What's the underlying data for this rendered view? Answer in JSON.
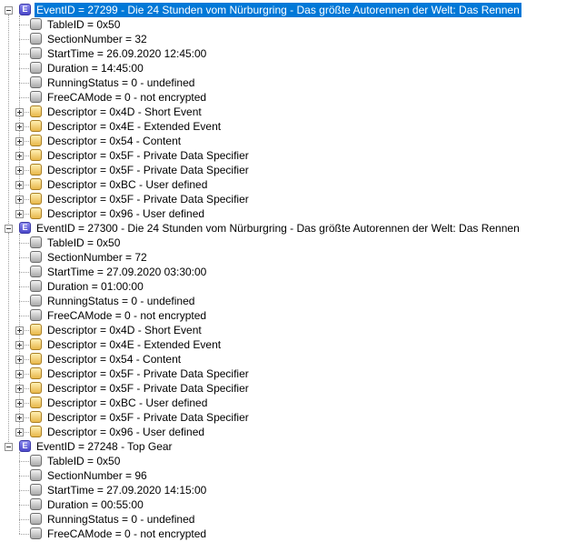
{
  "tree": {
    "events": [
      {
        "label": "EventID = 27299 - Die 24 Stunden vom Nürburgring - Das größte Autorennen der Welt: Das Rennen",
        "icon": "event-icon",
        "icon_text": "E",
        "selected": true,
        "children": [
          {
            "type": "field",
            "icon": "grey",
            "label": "TableID = 0x50"
          },
          {
            "type": "field",
            "icon": "grey",
            "label": "SectionNumber = 32"
          },
          {
            "type": "field",
            "icon": "grey",
            "label": "StartTime = 26.09.2020 12:45:00"
          },
          {
            "type": "field",
            "icon": "grey",
            "label": "Duration = 14:45:00"
          },
          {
            "type": "field",
            "icon": "grey",
            "label": "RunningStatus = 0 - undefined"
          },
          {
            "type": "field",
            "icon": "grey",
            "label": "FreeCAMode = 0 - not encrypted"
          },
          {
            "type": "descriptor",
            "icon": "yellow",
            "label": "Descriptor = 0x4D - Short Event"
          },
          {
            "type": "descriptor",
            "icon": "yellow",
            "label": "Descriptor = 0x4E - Extended Event"
          },
          {
            "type": "descriptor",
            "icon": "yellow",
            "label": "Descriptor = 0x54 - Content"
          },
          {
            "type": "descriptor",
            "icon": "yellow",
            "label": "Descriptor = 0x5F - Private Data Specifier"
          },
          {
            "type": "descriptor",
            "icon": "yellow",
            "label": "Descriptor = 0x5F - Private Data Specifier"
          },
          {
            "type": "descriptor",
            "icon": "yellow",
            "label": "Descriptor = 0xBC - User defined"
          },
          {
            "type": "descriptor",
            "icon": "yellow",
            "label": "Descriptor = 0x5F - Private Data Specifier"
          },
          {
            "type": "descriptor",
            "icon": "yellow",
            "label": "Descriptor = 0x96 - User defined"
          }
        ]
      },
      {
        "label": "EventID = 27300 - Die 24 Stunden vom Nürburgring - Das größte Autorennen der Welt: Das Rennen",
        "icon": "event-icon",
        "icon_text": "E",
        "selected": false,
        "children": [
          {
            "type": "field",
            "icon": "grey",
            "label": "TableID = 0x50"
          },
          {
            "type": "field",
            "icon": "grey",
            "label": "SectionNumber = 72"
          },
          {
            "type": "field",
            "icon": "grey",
            "label": "StartTime = 27.09.2020 03:30:00"
          },
          {
            "type": "field",
            "icon": "grey",
            "label": "Duration = 01:00:00"
          },
          {
            "type": "field",
            "icon": "grey",
            "label": "RunningStatus = 0 - undefined"
          },
          {
            "type": "field",
            "icon": "grey",
            "label": "FreeCAMode = 0 - not encrypted"
          },
          {
            "type": "descriptor",
            "icon": "yellow",
            "label": "Descriptor = 0x4D - Short Event"
          },
          {
            "type": "descriptor",
            "icon": "yellow",
            "label": "Descriptor = 0x4E - Extended Event"
          },
          {
            "type": "descriptor",
            "icon": "yellow",
            "label": "Descriptor = 0x54 - Content"
          },
          {
            "type": "descriptor",
            "icon": "yellow",
            "label": "Descriptor = 0x5F - Private Data Specifier"
          },
          {
            "type": "descriptor",
            "icon": "yellow",
            "label": "Descriptor = 0x5F - Private Data Specifier"
          },
          {
            "type": "descriptor",
            "icon": "yellow",
            "label": "Descriptor = 0xBC - User defined"
          },
          {
            "type": "descriptor",
            "icon": "yellow",
            "label": "Descriptor = 0x5F - Private Data Specifier"
          },
          {
            "type": "descriptor",
            "icon": "yellow",
            "label": "Descriptor = 0x96 - User defined"
          }
        ]
      },
      {
        "label": "EventID = 27248 - Top Gear",
        "icon": "event-icon",
        "icon_text": "E",
        "selected": false,
        "children": [
          {
            "type": "field",
            "icon": "grey",
            "label": "TableID = 0x50"
          },
          {
            "type": "field",
            "icon": "grey",
            "label": "SectionNumber = 96"
          },
          {
            "type": "field",
            "icon": "grey",
            "label": "StartTime = 27.09.2020 14:15:00"
          },
          {
            "type": "field",
            "icon": "grey",
            "label": "Duration = 00:55:00"
          },
          {
            "type": "field",
            "icon": "grey",
            "label": "RunningStatus = 0 - undefined"
          },
          {
            "type": "field",
            "icon": "grey",
            "label": "FreeCAMode = 0 - not encrypted"
          }
        ]
      }
    ]
  },
  "colors": {
    "selection": "#0078d7",
    "event_icon": "#5b58d6",
    "field_icon": "#bdbdbd",
    "descriptor_icon": "#f4cd6a"
  }
}
